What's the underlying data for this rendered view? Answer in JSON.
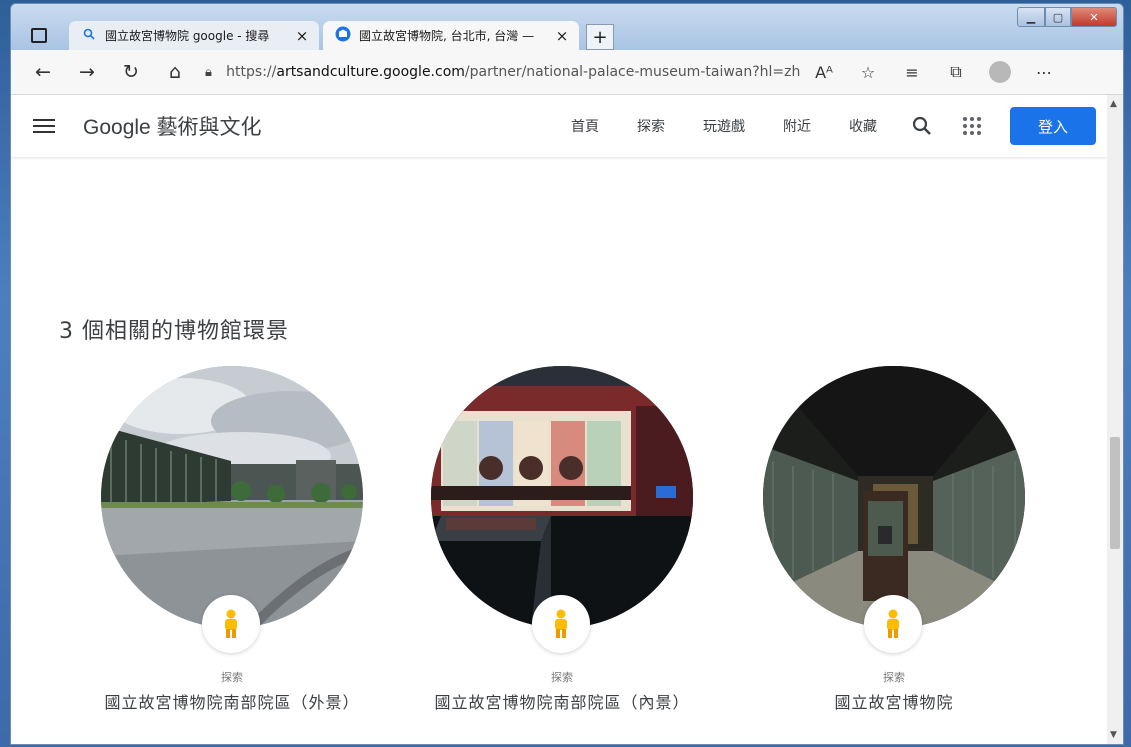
{
  "browser": {
    "tabs": [
      {
        "title": "國立故宮博物院 google - 搜尋",
        "close": "×",
        "favicon": "search-icon"
      },
      {
        "title": "國立故宮博物院, 台北市, 台灣 —",
        "close": "×",
        "favicon": "arts-culture-icon"
      }
    ],
    "new_tab": "+",
    "url": {
      "prefix": "https://",
      "host": "artsandculture.google.com",
      "path": "/partner/national-palace-museum-taiwan?hl=zh-tw"
    },
    "read_aloud": "Aᴬ"
  },
  "site": {
    "logo": "Google 藝術與文化",
    "nav": [
      "首頁",
      "探索",
      "玩遊戲",
      "附近",
      "收藏"
    ],
    "signin": "登入"
  },
  "section": {
    "title": "3 個相關的博物館環景"
  },
  "cards": [
    {
      "kicker": "探索",
      "name": "國立故宮博物院南部院區（外景）"
    },
    {
      "kicker": "探索",
      "name": "國立故宮博物院南部院區（內景）"
    },
    {
      "kicker": "探索",
      "name": "國立故宮博物院"
    }
  ],
  "colors": {
    "accent": "#1a73e8",
    "pegman": "#fbbc04"
  }
}
